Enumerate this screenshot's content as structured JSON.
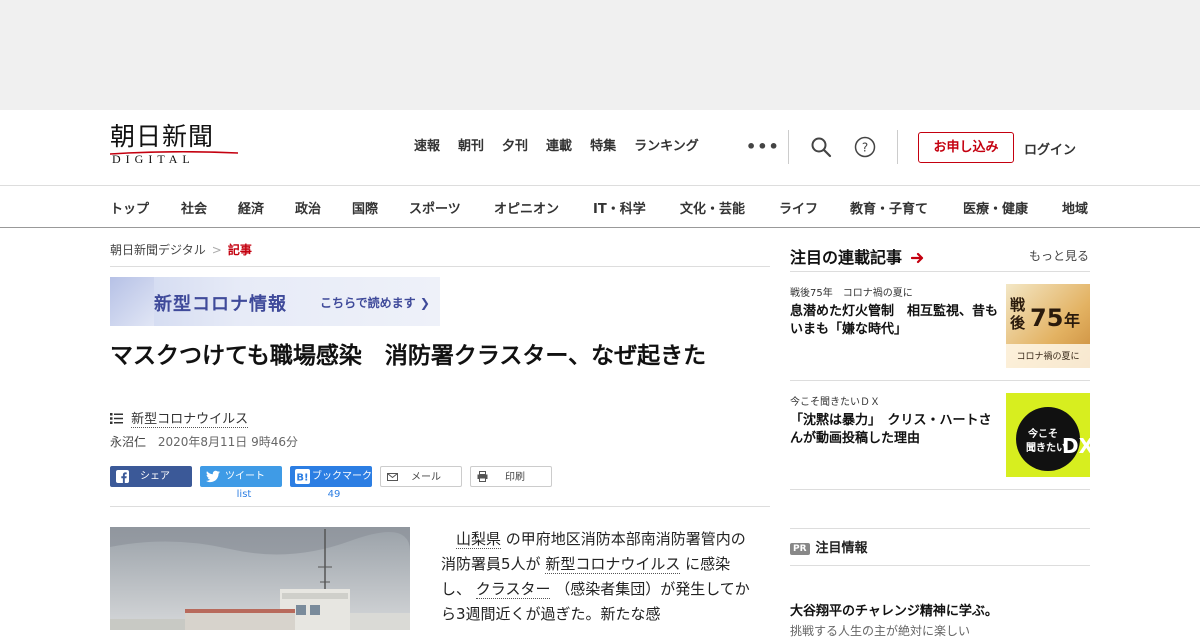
{
  "header": {
    "logo_kanji": "朝日新聞",
    "logo_sub": "DIGITAL",
    "topnav": [
      "速報",
      "朝刊",
      "夕刊",
      "連載",
      "特集",
      "ランキング"
    ],
    "more": "•••",
    "apply": "お申し込み",
    "login": "ログイン"
  },
  "catnav": [
    "トップ",
    "社会",
    "経済",
    "政治",
    "国際",
    "スポーツ",
    "オピニオン",
    "IT・科学",
    "文化・芸能",
    "ライフ",
    "教育・子育て",
    "医療・健康",
    "地域"
  ],
  "breadcrumb": {
    "home": "朝日新聞デジタル",
    "sep": ">",
    "current": "記事"
  },
  "banner": {
    "title": "新型コロナ情報",
    "cta": "こちらで読めます ❯"
  },
  "article": {
    "headline": "マスクつけても職場感染　消防署クラスター、なぜ起きた",
    "tag": "新型コロナウイルス",
    "author": "永沼仁",
    "date": "2020年8月11日 9時46分",
    "share": {
      "facebook": "シェア",
      "twitter": "ツイート",
      "twitter_count": "list",
      "hatena": "ブックマーク",
      "hatena_count": "49",
      "mail": "メール",
      "print": "印刷"
    },
    "body": {
      "l1a": "山梨県",
      "l1b": " の甲府地区消防本部南消防署管内の消防署員5人が ",
      "l2a": "新型コロナウイルス",
      "l2b": " に感染し、 ",
      "l3a": "クラスター",
      "l3b": " （感染者集団）が発生してから3週間近くが過ぎた。新たな感"
    }
  },
  "sidebar": {
    "title": "注目の連載記事",
    "more": "もっと見る",
    "items": [
      {
        "kicker": "戦後75年　コロナ禍の夏に",
        "title": "息潜めた灯火管制　相互監視、昔もいまも「嫌な時代」",
        "thumb_text": "戦後75年",
        "thumb_sub": "コロナ禍の夏に"
      },
      {
        "kicker": "今こそ聞きたいＤＸ",
        "title": "「沈黙は暴力」　クリス・ハートさんが動画投稿した理由",
        "thumb_text": "今こそ聞きたいDX"
      }
    ],
    "pr_badge": "PR",
    "pr_title": "注目情報",
    "pr_item": "大谷翔平のチャレンジ精神に学ぶ。",
    "pr_sub": "挑戦する人生の主が絶対に楽しい"
  },
  "colors": {
    "accent": "#c4000f",
    "facebook": "#3b5998",
    "twitter": "#3f9be6",
    "hatena": "#2c7ee3",
    "banner_text": "#3f4a9a"
  }
}
